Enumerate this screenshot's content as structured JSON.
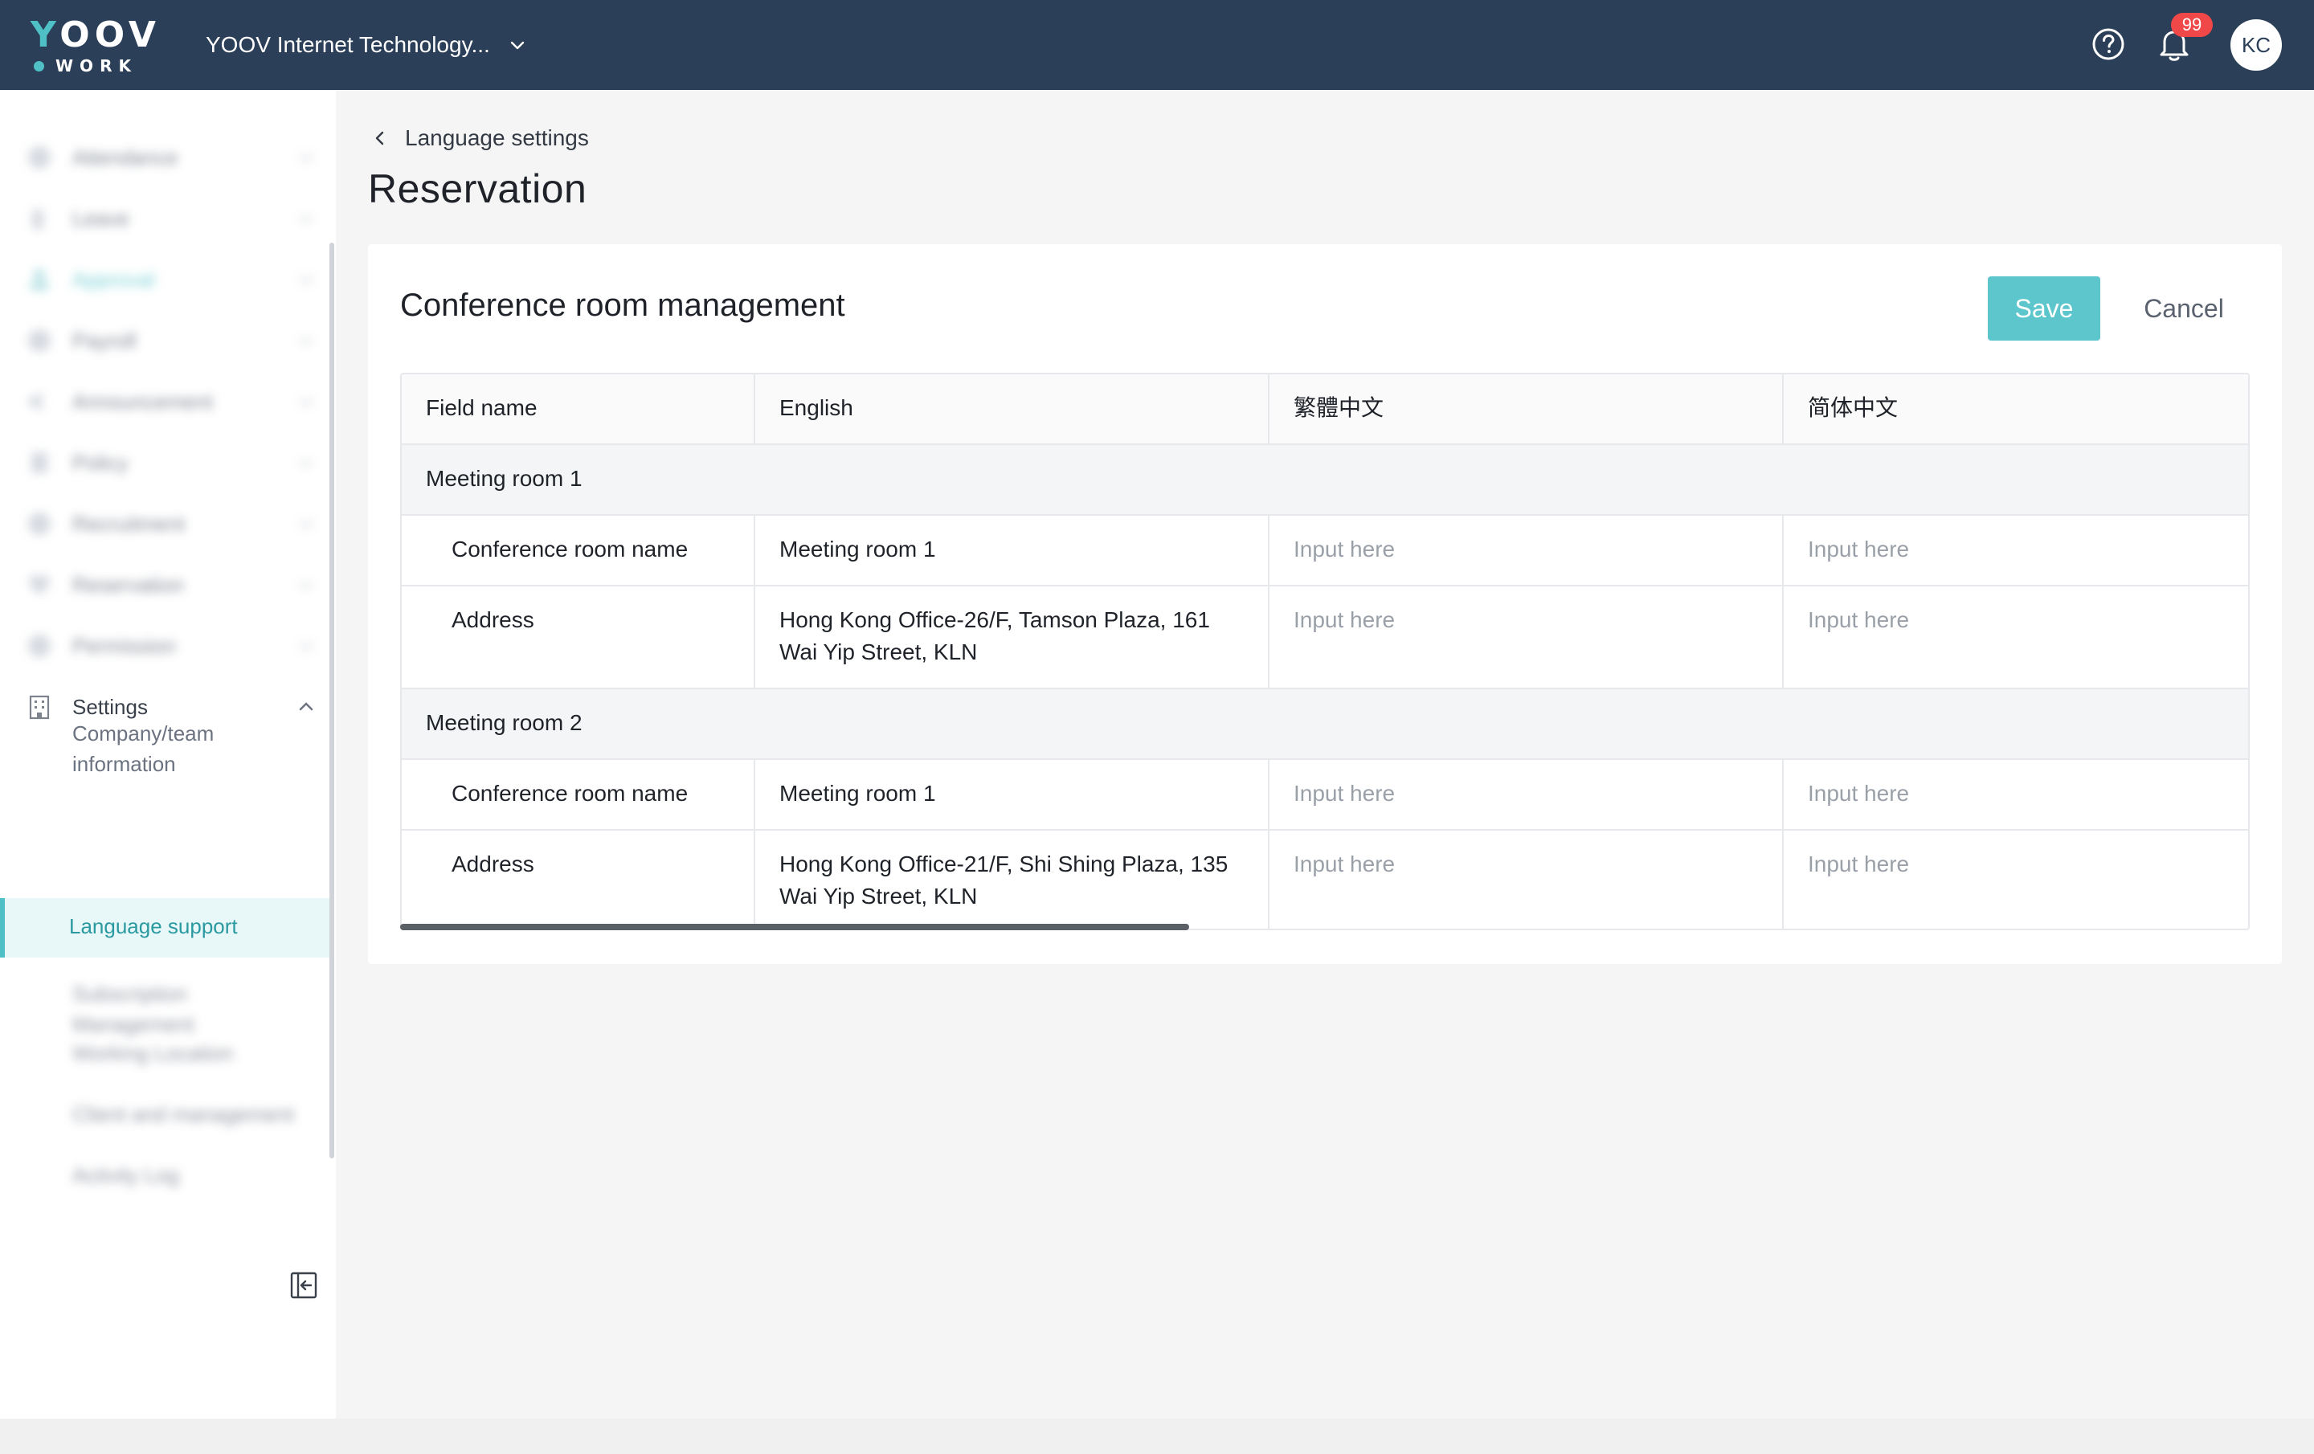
{
  "topbar": {
    "logo_top": "YOOV",
    "logo_bottom": "WORK",
    "company_name": "YOOV Internet Technology...",
    "notification_count": "99",
    "avatar_initials": "KC"
  },
  "sidebar": {
    "items": [
      {
        "label": "Attendance",
        "icon": "clock-icon"
      },
      {
        "label": "Leave",
        "icon": "leave-icon"
      },
      {
        "label": "Approval",
        "icon": "approval-user-icon"
      },
      {
        "label": "Payroll",
        "icon": "payroll-icon"
      },
      {
        "label": "Announcement",
        "icon": "megaphone-icon"
      },
      {
        "label": "Policy",
        "icon": "policy-icon"
      },
      {
        "label": "Recruitment",
        "icon": "recruitment-icon"
      },
      {
        "label": "Reservation",
        "icon": "reservation-icon"
      },
      {
        "label": "Permission",
        "icon": "permission-icon"
      }
    ],
    "settings_label": "Settings",
    "sub_items": [
      {
        "label": "Company/team information"
      },
      {
        "label": "Language support"
      },
      {
        "label": "Subscription Management"
      },
      {
        "label": "Working Location"
      },
      {
        "label": "Client and management"
      },
      {
        "label": "Activity Log"
      }
    ],
    "active_color": "#4fc1c6"
  },
  "breadcrumb": "Language settings",
  "page_title": "Reservation",
  "card": {
    "title": "Conference room management",
    "save_label": "Save",
    "cancel_label": "Cancel"
  },
  "table": {
    "headers": [
      "Field name",
      "English",
      "繁體中文",
      "简体中文"
    ],
    "placeholder": "Input here",
    "groups": [
      {
        "name": "Meeting room 1",
        "rows": [
          {
            "field": "Conference room name",
            "english": "Meeting room 1"
          },
          {
            "field": "Address",
            "english": "Hong Kong Office-26/F, Tamson Plaza, 161 Wai Yip Street, KLN"
          }
        ]
      },
      {
        "name": "Meeting room 2",
        "rows": [
          {
            "field": "Conference room name",
            "english": "Meeting room 1"
          },
          {
            "field": "Address",
            "english": "Hong Kong Office-21/F, Shi Shing Plaza, 135 Wai Yip Street, KLN"
          }
        ]
      }
    ]
  },
  "colors": {
    "topbar": "#2b3f58",
    "accent": "#4fc1c6",
    "save_button": "#5cc6cc",
    "badge": "#f04848"
  }
}
